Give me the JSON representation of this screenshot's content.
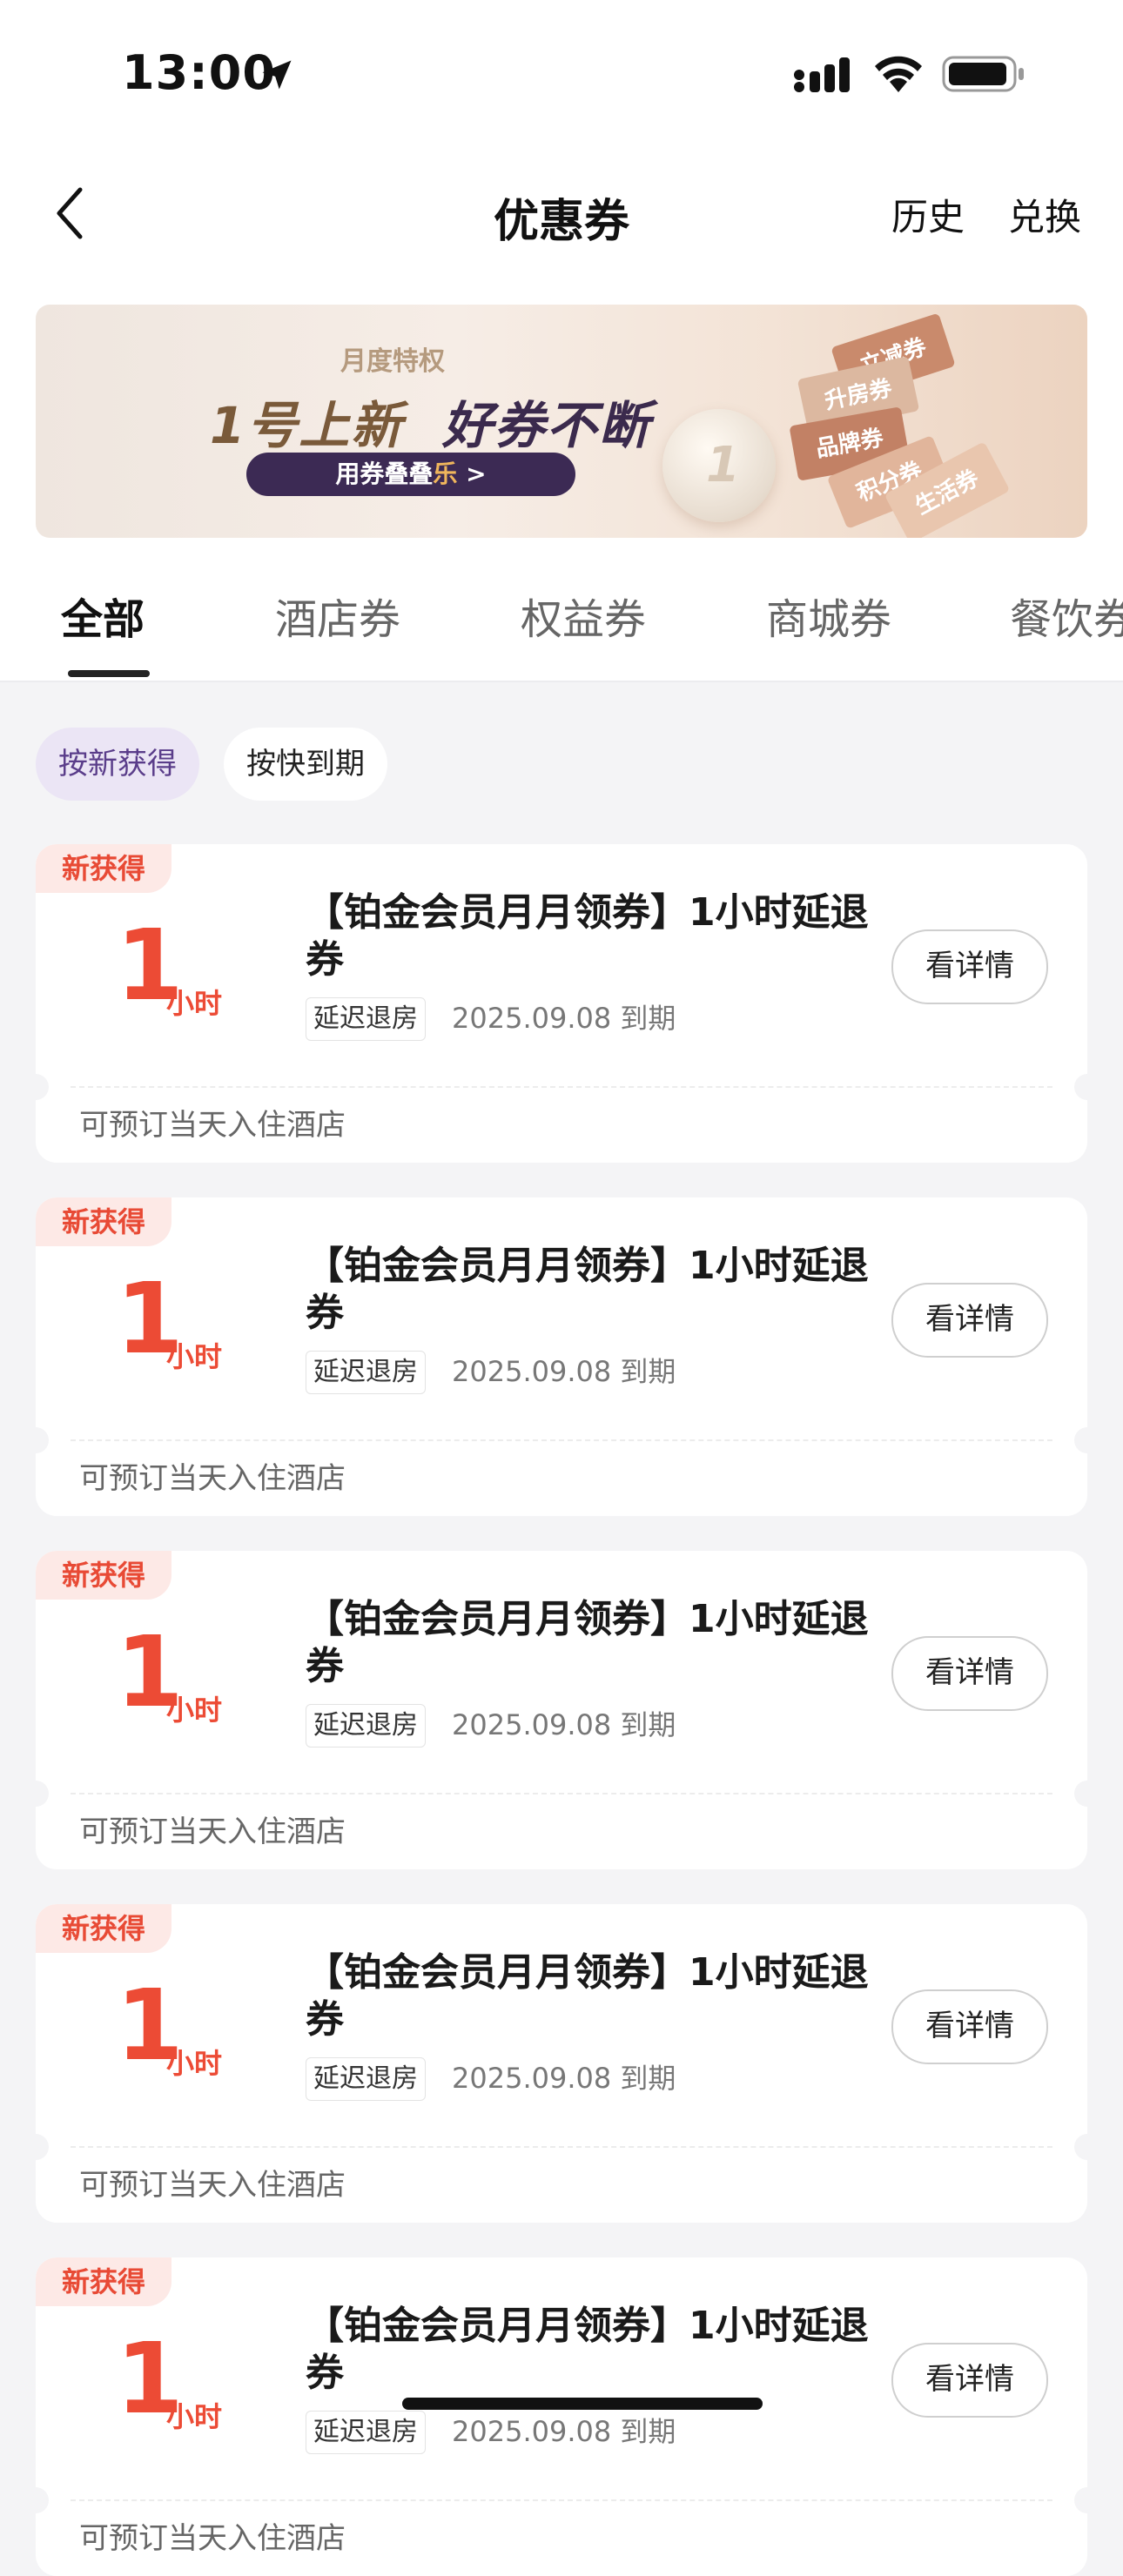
{
  "status": {
    "time": "13:00"
  },
  "nav": {
    "title": "优惠券",
    "history": "历史",
    "exchange": "兑换"
  },
  "banner": {
    "subtitle": "月度特权",
    "headline_a": "1号上新",
    "headline_b": "好券不断",
    "button_a": "用券叠叠",
    "button_b": "乐",
    "button_c": " >",
    "tags": [
      "立减券",
      "升房券",
      "品牌券",
      "积分券",
      "生活券"
    ],
    "coin_text": "1"
  },
  "tabs": [
    "全部",
    "酒店券",
    "权益券",
    "商城券",
    "餐饮券"
  ],
  "active_tab": 0,
  "filters": {
    "newest": "按新获得",
    "expiring": "按快到期",
    "active": "newest"
  },
  "coupons": [
    {
      "badge": "新获得",
      "amount": "1",
      "unit": "小时",
      "title": "【铂金会员月月领券】1小时延退券",
      "tag": "延迟退房",
      "expire": "2025.09.08 到期",
      "button": "看详情",
      "footer": "可预订当天入住酒店"
    },
    {
      "badge": "新获得",
      "amount": "1",
      "unit": "小时",
      "title": "【铂金会员月月领券】1小时延退券",
      "tag": "延迟退房",
      "expire": "2025.09.08 到期",
      "button": "看详情",
      "footer": "可预订当天入住酒店"
    },
    {
      "badge": "新获得",
      "amount": "1",
      "unit": "小时",
      "title": "【铂金会员月月领券】1小时延退券",
      "tag": "延迟退房",
      "expire": "2025.09.08 到期",
      "button": "看详情",
      "footer": "可预订当天入住酒店"
    },
    {
      "badge": "新获得",
      "amount": "1",
      "unit": "小时",
      "title": "【铂金会员月月领券】1小时延退券",
      "tag": "延迟退房",
      "expire": "2025.09.08 到期",
      "button": "看详情",
      "footer": "可预订当天入住酒店"
    },
    {
      "badge": "新获得",
      "amount": "1",
      "unit": "小时",
      "title": "【铂金会员月月领券】1小时延退券",
      "tag": "延迟退房",
      "expire": "2025.09.08 到期",
      "button": "看详情",
      "footer": "可预订当天入住酒店"
    }
  ],
  "colors": {
    "accent_red": "#ec4b35",
    "badge_bg": "#fde9e6",
    "filter_active_bg": "#ebe5f5",
    "banner_button": "#3c2a54",
    "page_bg": "#f4f4f6"
  }
}
